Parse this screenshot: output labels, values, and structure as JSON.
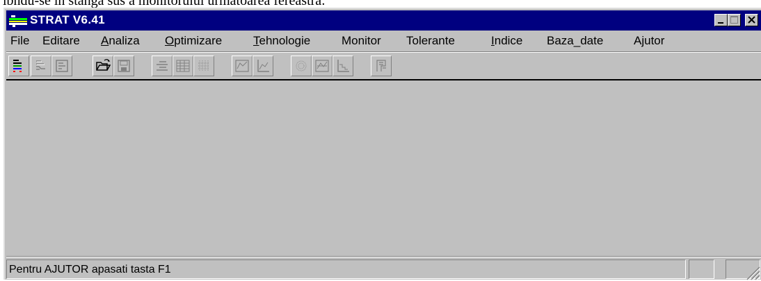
{
  "page_caption": "ibndu-se in stanga sus a monitorului urmatoarea fereastra:",
  "window": {
    "title": "STRAT V6.41",
    "controls": [
      "minimize",
      "maximize",
      "close"
    ]
  },
  "menu": {
    "items": [
      {
        "label": "File",
        "mnemonic": "",
        "rest": ""
      },
      {
        "label": "Editare",
        "mnemonic": "",
        "rest": ""
      },
      {
        "label": "Analiza",
        "mnemonic": "A",
        "rest": "naliza"
      },
      {
        "label": "Optimizare",
        "mnemonic": "O",
        "rest": "ptimizare"
      },
      {
        "label": "Tehnologie",
        "mnemonic": "T",
        "rest": "ehnologie"
      },
      {
        "label": "Monitor",
        "mnemonic": "",
        "rest": ""
      },
      {
        "label": "Tolerante",
        "mnemonic": "",
        "rest": ""
      },
      {
        "label": "Indice",
        "mnemonic": "I",
        "rest": "ndice"
      },
      {
        "label": "Baza_date",
        "mnemonic": "",
        "rest": ""
      },
      {
        "label": "Ajutor",
        "mnemonic": "",
        "rest": ""
      }
    ]
  },
  "toolbar": {
    "icons": [
      "strat-color-icon",
      "strat-disabled-icon",
      "strat-frame-icon",
      "open-folder-icon",
      "save-disk-icon",
      "list-icon",
      "grid-icon",
      "dots-grid-icon",
      "chart-icon",
      "graph-icon",
      "sphere-icon",
      "surface-icon",
      "step-icon",
      "profile-icon"
    ]
  },
  "status": {
    "message": "Pentru AJUTOR apasati tasta F1",
    "pane2": "",
    "pane3": ""
  },
  "colors": {
    "titlebar": "#000080",
    "face": "#c0c0c0"
  }
}
